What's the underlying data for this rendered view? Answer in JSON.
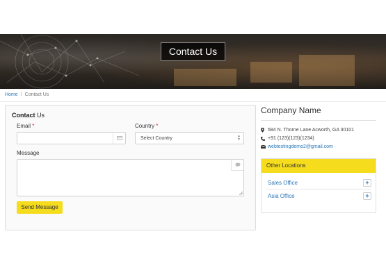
{
  "hero": {
    "title": "Contact Us"
  },
  "breadcrumb": {
    "home": "Home",
    "separator": "/",
    "current": "Contact Us"
  },
  "form": {
    "title_bold": "Contact",
    "title_rest": " Us",
    "email_label": "Email",
    "required_mark": "*",
    "email_value": "",
    "email_icon": "envelope-icon",
    "country_label": "Country",
    "country_selected": "Select Country",
    "message_label": "Message",
    "message_value": "",
    "message_icon": "comment-icon",
    "send_label": "Send Message"
  },
  "company": {
    "name": "Company Name",
    "address": "584 N. Thorne Lane Acworth, GA 30101",
    "phone": "+91 (123)(123)(1234)",
    "email": "webtestingdemo2@gmail.com"
  },
  "locations": {
    "heading": "Other Locations",
    "items": [
      {
        "label": "Sales Office",
        "toggle": "+"
      },
      {
        "label": "Asia Office",
        "toggle": "+"
      }
    ]
  },
  "colors": {
    "accent": "#f5dc1c",
    "link": "#2a77b8",
    "required": "#d9232d"
  }
}
